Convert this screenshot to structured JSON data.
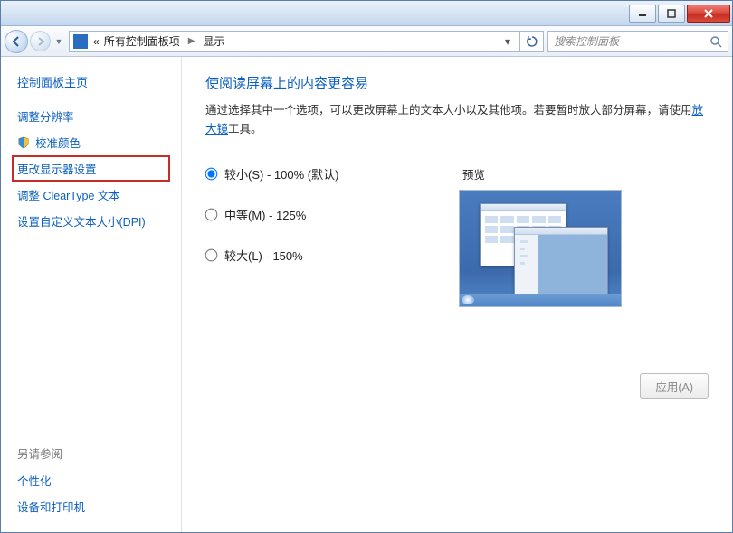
{
  "breadcrumb": {
    "root_marker": "«",
    "parent": "所有控制面板项",
    "current": "显示"
  },
  "search": {
    "placeholder": "搜索控制面板"
  },
  "sidebar": {
    "home": "控制面板主页",
    "items": [
      "调整分辨率",
      "校准颜色",
      "更改显示器设置",
      "调整 ClearType 文本",
      "设置自定义文本大小(DPI)"
    ]
  },
  "see_also": {
    "label": "另请参阅",
    "items": [
      "个性化",
      "设备和打印机"
    ]
  },
  "page": {
    "title": "使阅读屏幕上的内容更容易",
    "desc_before": "通过选择其中一个选项，可以更改屏幕上的文本大小以及其他项。若要暂时放大部分屏幕，请使用",
    "magnifier_link": "放大镜",
    "desc_after": "工具。"
  },
  "options": {
    "small": "较小(S) - 100% (默认)",
    "medium": "中等(M) - 125%",
    "large": "较大(L) - 150%",
    "preview_label": "预览"
  },
  "apply_label": "应用(A)"
}
